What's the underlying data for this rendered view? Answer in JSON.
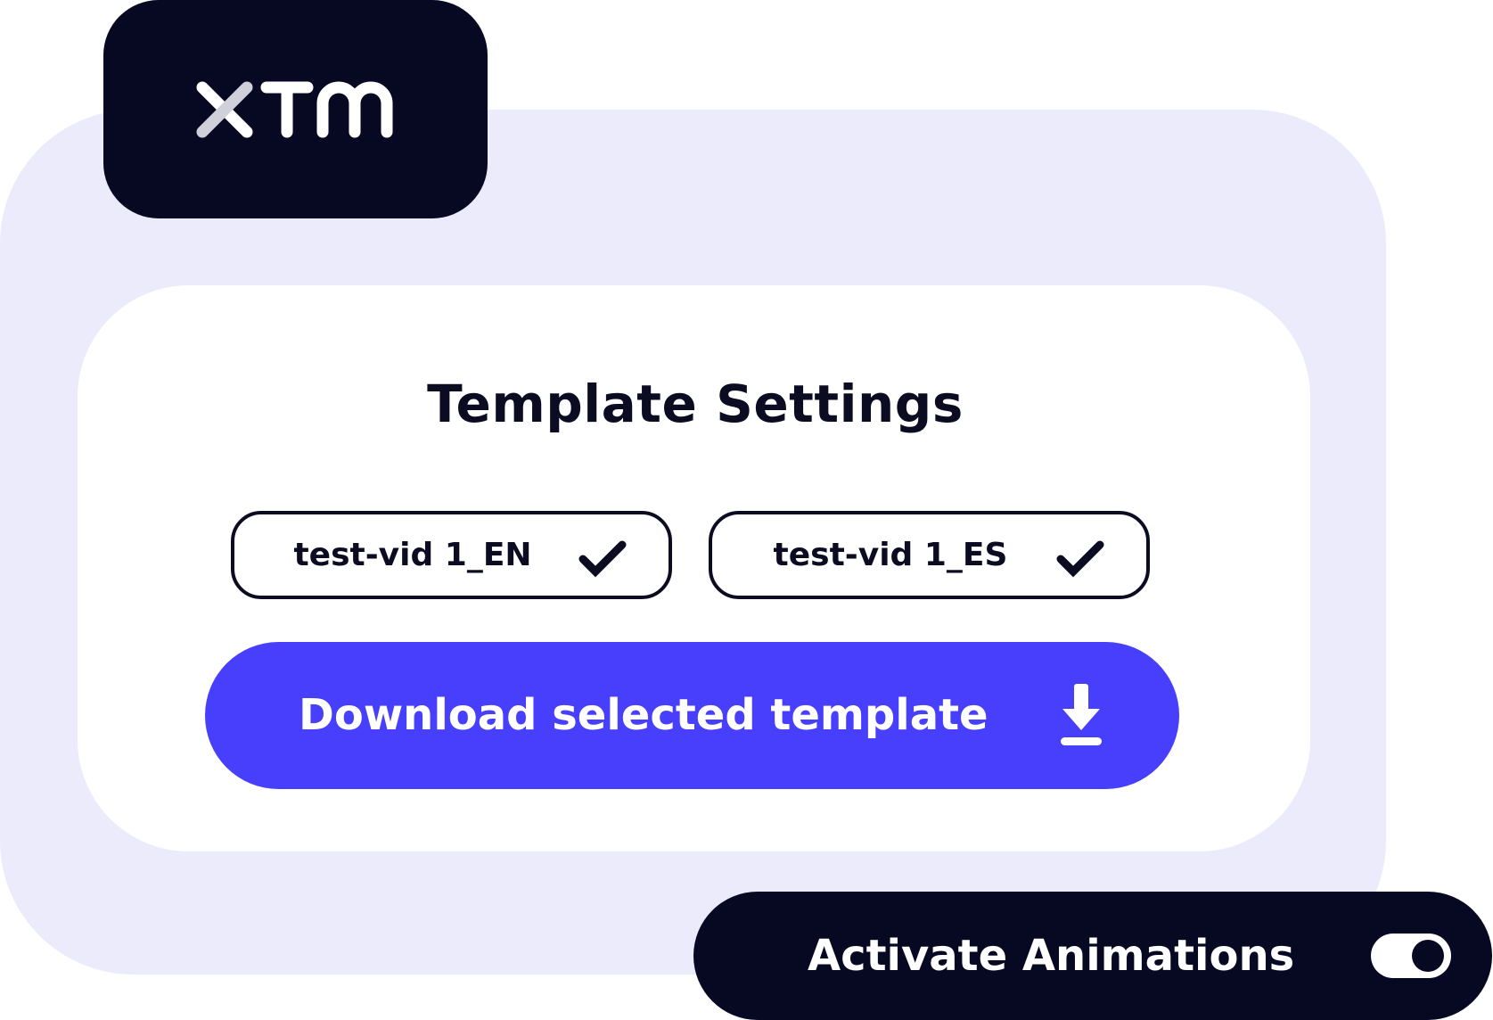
{
  "brand": {
    "logo_text": "XTM",
    "logo_icon": "xtm-logo"
  },
  "template_settings": {
    "title": "Template Settings",
    "options": [
      {
        "label": "test-vid 1_EN",
        "selected": true,
        "icon": "check-icon"
      },
      {
        "label": "test-vid 1_ES",
        "selected": true,
        "icon": "check-icon"
      }
    ],
    "download_button": {
      "label": "Download selected template",
      "icon": "download-icon"
    }
  },
  "animations": {
    "label": "Activate Animations",
    "enabled": true
  },
  "colors": {
    "accent": "#473ffc",
    "dark": "#070822",
    "panel_background": "#ecebfc",
    "card_background": "#ffffff"
  }
}
